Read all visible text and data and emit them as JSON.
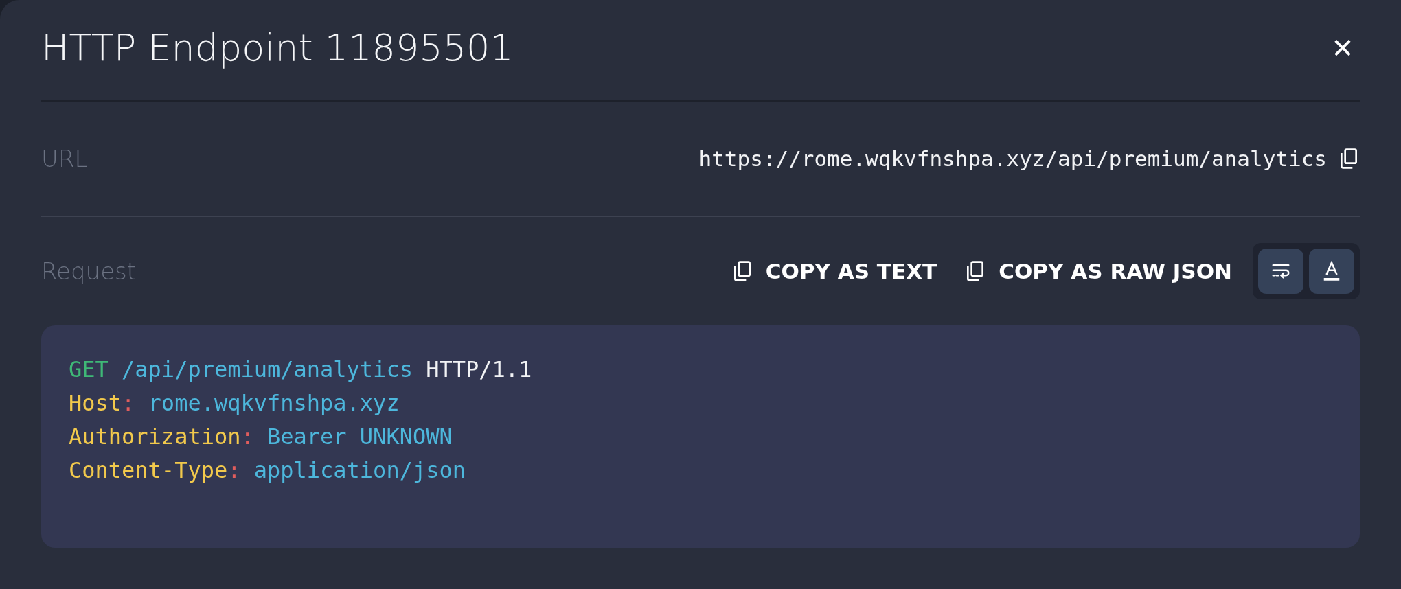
{
  "dialog": {
    "title": "HTTP Endpoint 11895501",
    "close": "×"
  },
  "url": {
    "label": "URL",
    "value": "https://rome.wqkvfnshpa.xyz/api/premium/analytics"
  },
  "request": {
    "label": "Request",
    "actions": [
      {
        "label": "COPY AS TEXT"
      },
      {
        "label": "COPY AS RAW JSON"
      }
    ],
    "toggles": [
      {
        "kind": "wrap"
      },
      {
        "kind": "font"
      }
    ],
    "code_lines": [
      [
        {
          "kind": "method",
          "text": "GET"
        },
        {
          "kind": "value",
          "text": " /api/premium/analytics"
        },
        {
          "kind": "plain",
          "text": " HTTP/1.1"
        }
      ],
      [
        {
          "kind": "key",
          "text": "Host"
        },
        {
          "kind": "punct",
          "text": ":"
        },
        {
          "kind": "value",
          "text": " rome.wqkvfnshpa.xyz"
        }
      ],
      [
        {
          "kind": "key",
          "text": "Authorization"
        },
        {
          "kind": "punct",
          "text": ":"
        },
        {
          "kind": "value",
          "text": " Bearer UNKNOWN"
        }
      ],
      [
        {
          "kind": "key",
          "text": "Content-Type"
        },
        {
          "kind": "punct",
          "text": ":"
        },
        {
          "kind": "value",
          "text": " application/json"
        }
      ]
    ]
  }
}
